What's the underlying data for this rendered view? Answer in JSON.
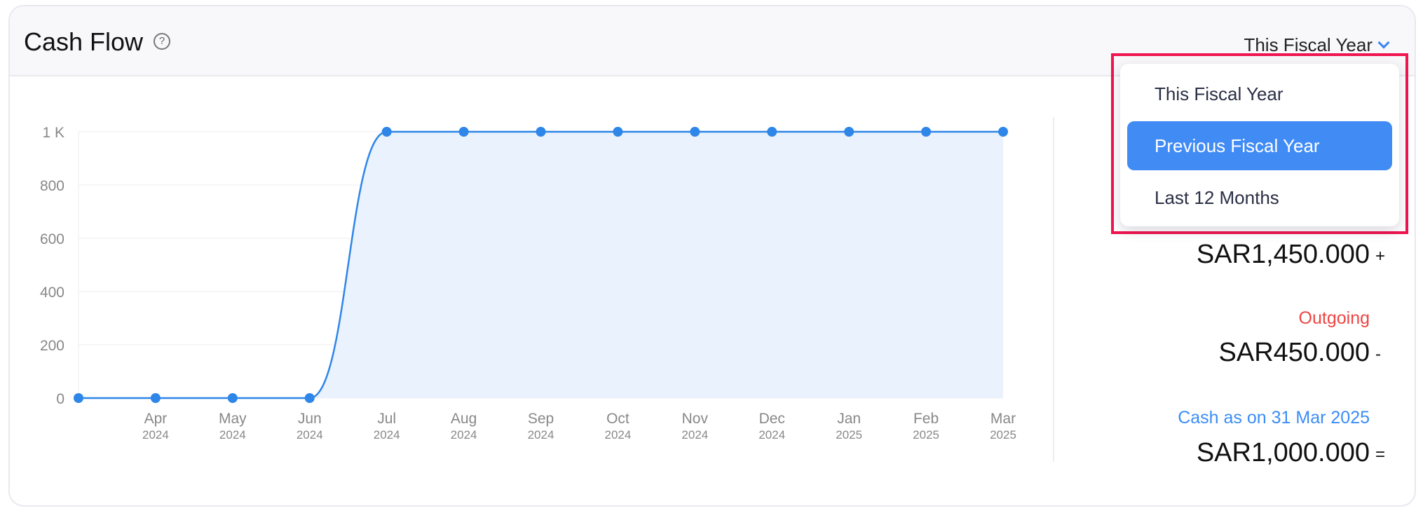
{
  "header": {
    "title": "Cash Flow",
    "help_icon": "question-circle-icon",
    "period_selected": "This Fiscal Year"
  },
  "dropdown": {
    "options": [
      "This Fiscal Year",
      "Previous Fiscal Year",
      "Last 12 Months"
    ],
    "highlighted": "Previous Fiscal Year"
  },
  "summary": {
    "incoming_amount": "SAR1,450.000",
    "incoming_op": "+",
    "outgoing_label": "Outgoing",
    "outgoing_amount": "SAR450.000",
    "outgoing_op": "-",
    "cash_label": "Cash as on 31 Mar 2025",
    "cash_amount": "SAR1,000.000",
    "cash_op": "=",
    "colors": {
      "outgoing": "#ef4444",
      "cash": "#3b8df5"
    }
  },
  "chart_data": {
    "type": "area",
    "x": [
      {
        "m": "",
        "y": ""
      },
      {
        "m": "Apr",
        "y": "2024"
      },
      {
        "m": "May",
        "y": "2024"
      },
      {
        "m": "Jun",
        "y": "2024"
      },
      {
        "m": "Jul",
        "y": "2024"
      },
      {
        "m": "Aug",
        "y": "2024"
      },
      {
        "m": "Sep",
        "y": "2024"
      },
      {
        "m": "Oct",
        "y": "2024"
      },
      {
        "m": "Nov",
        "y": "2024"
      },
      {
        "m": "Dec",
        "y": "2024"
      },
      {
        "m": "Jan",
        "y": "2025"
      },
      {
        "m": "Feb",
        "y": "2025"
      },
      {
        "m": "Mar",
        "y": "2025"
      }
    ],
    "values": [
      0,
      0,
      0,
      0,
      1000,
      1000,
      1000,
      1000,
      1000,
      1000,
      1000,
      1000,
      1000
    ],
    "yticks": [
      {
        "v": 0,
        "label": "0"
      },
      {
        "v": 200,
        "label": "200"
      },
      {
        "v": 400,
        "label": "400"
      },
      {
        "v": 600,
        "label": "600"
      },
      {
        "v": 800,
        "label": "800"
      },
      {
        "v": 1000,
        "label": "1 K"
      }
    ],
    "ylim": [
      0,
      1000
    ],
    "grid": true,
    "colors": {
      "line": "#2e86e8",
      "fill": "#eaf2fd"
    }
  }
}
